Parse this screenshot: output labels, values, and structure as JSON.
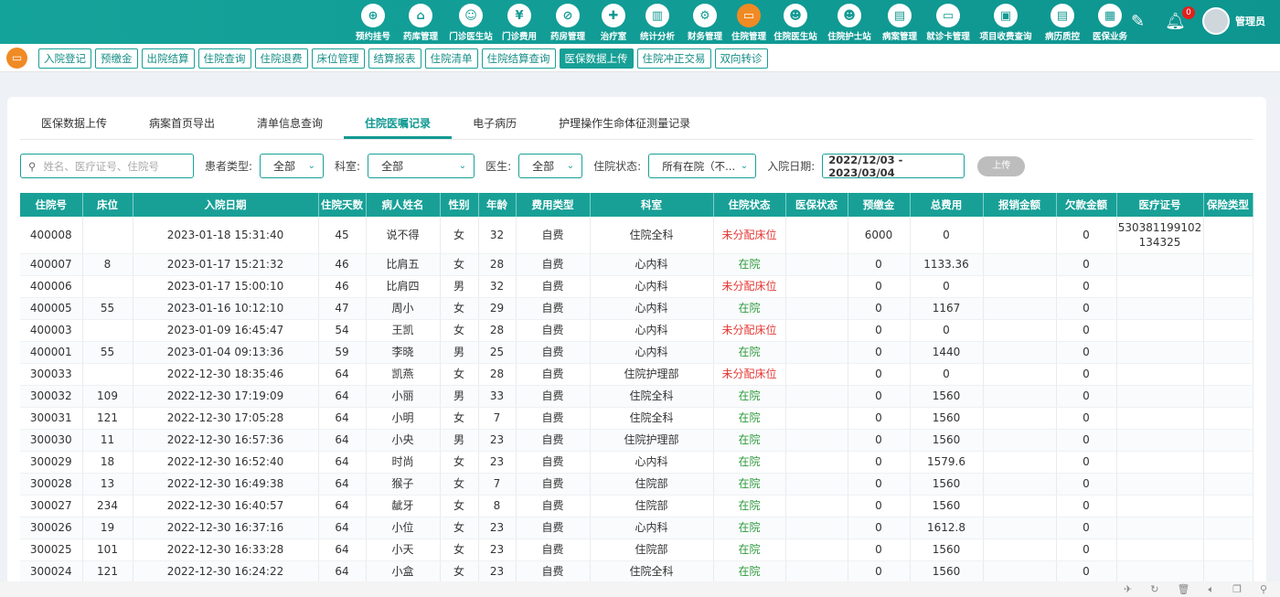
{
  "nav": [
    {
      "label": "预约挂号",
      "icon": "calendar-plus-icon",
      "g": "⊕"
    },
    {
      "label": "药库管理",
      "icon": "warehouse-icon",
      "g": "⌂"
    },
    {
      "label": "门诊医生站",
      "icon": "doctor-icon",
      "g": "☺"
    },
    {
      "label": "门诊费用",
      "icon": "yen-icon",
      "g": "¥"
    },
    {
      "label": "药房管理",
      "icon": "pill-icon",
      "g": "⊘"
    },
    {
      "label": "治疗室",
      "icon": "nurse-icon",
      "g": "✚"
    },
    {
      "label": "统计分析",
      "icon": "chart-icon",
      "g": "▥"
    },
    {
      "label": "财务管理",
      "icon": "gear-icon",
      "g": "⚙"
    },
    {
      "label": "住院管理",
      "icon": "bed-icon",
      "g": "▭",
      "active": true
    },
    {
      "label": "住院医生站",
      "icon": "doctor-card-icon",
      "g": "☻"
    },
    {
      "label": "住院护士站",
      "icon": "nurse-station-icon",
      "g": "☻"
    },
    {
      "label": "病案管理",
      "icon": "record-icon",
      "g": "▤"
    },
    {
      "label": "就诊卡管理",
      "icon": "card-icon",
      "g": "▭"
    },
    {
      "label": "项目收费查询",
      "icon": "search-doc-icon",
      "g": "▣"
    },
    {
      "label": "病历质控",
      "icon": "quality-icon",
      "g": "▤"
    },
    {
      "label": "医保业务",
      "icon": "insurance-icon",
      "g": "▦"
    }
  ],
  "header": {
    "notifications": "0",
    "user": "管理员"
  },
  "subnav": [
    {
      "label": "入院登记"
    },
    {
      "label": "预缴金"
    },
    {
      "label": "出院结算"
    },
    {
      "label": "住院查询"
    },
    {
      "label": "住院退费"
    },
    {
      "label": "床位管理"
    },
    {
      "label": "结算报表"
    },
    {
      "label": "住院清单"
    },
    {
      "label": "住院结算查询"
    },
    {
      "label": "医保数据上传",
      "active": true
    },
    {
      "label": "住院冲正交易"
    },
    {
      "label": "双向转诊"
    }
  ],
  "tabs": [
    {
      "label": "医保数据上传"
    },
    {
      "label": "病案首页导出"
    },
    {
      "label": "清单信息查询"
    },
    {
      "label": "住院医嘱记录",
      "active": true
    },
    {
      "label": "电子病历"
    },
    {
      "label": "护理操作生命体征测量记录"
    }
  ],
  "filters": {
    "search_placeholder": "姓名、医疗证号、住院号",
    "patient_type_label": "患者类型:",
    "patient_type": "全部",
    "dept_label": "科室:",
    "dept": "全部",
    "doctor_label": "医生:",
    "doctor": "全部",
    "status_label": "住院状态:",
    "status": "所有在院（不...",
    "date_label": "入院日期:",
    "date": "2022/12/03 - 2023/03/04",
    "upload": "上传"
  },
  "table": {
    "columns": [
      "住院号",
      "床位",
      "入院日期",
      "住院天数",
      "病人姓名",
      "性别",
      "年龄",
      "费用类型",
      "科室",
      "住院状态",
      "医保状态",
      "预缴金",
      "总费用",
      "报销金额",
      "欠款金额",
      "医疗证号",
      "保险类型"
    ],
    "rows": [
      [
        "400008",
        "",
        "2023-01-18 15:31:40",
        "45",
        "说不得",
        "女",
        "32",
        "自费",
        "住院全科",
        "未分配床位",
        "",
        "6000",
        "0",
        "",
        "0",
        "530381199102134325",
        ""
      ],
      [
        "400007",
        "8",
        "2023-01-17 15:21:32",
        "46",
        "比肩五",
        "女",
        "28",
        "自费",
        "心内科",
        "在院",
        "",
        "0",
        "1133.36",
        "",
        "0",
        "",
        ""
      ],
      [
        "400006",
        "",
        "2023-01-17 15:00:10",
        "46",
        "比肩四",
        "男",
        "32",
        "自费",
        "心内科",
        "未分配床位",
        "",
        "0",
        "0",
        "",
        "0",
        "",
        ""
      ],
      [
        "400005",
        "55",
        "2023-01-16 10:12:10",
        "47",
        "周小",
        "女",
        "29",
        "自费",
        "心内科",
        "在院",
        "",
        "0",
        "1167",
        "",
        "0",
        "",
        ""
      ],
      [
        "400003",
        "",
        "2023-01-09 16:45:47",
        "54",
        "王凯",
        "女",
        "28",
        "自费",
        "心内科",
        "未分配床位",
        "",
        "0",
        "0",
        "",
        "0",
        "",
        ""
      ],
      [
        "400001",
        "55",
        "2023-01-04 09:13:36",
        "59",
        "李晓",
        "男",
        "25",
        "自费",
        "心内科",
        "在院",
        "",
        "0",
        "1440",
        "",
        "0",
        "",
        ""
      ],
      [
        "300033",
        "",
        "2022-12-30 18:35:46",
        "64",
        "凯燕",
        "女",
        "28",
        "自费",
        "住院护理部",
        "未分配床位",
        "",
        "0",
        "0",
        "",
        "0",
        "",
        ""
      ],
      [
        "300032",
        "109",
        "2022-12-30 17:19:09",
        "64",
        "小丽",
        "男",
        "33",
        "自费",
        "住院全科",
        "在院",
        "",
        "0",
        "1560",
        "",
        "0",
        "",
        ""
      ],
      [
        "300031",
        "121",
        "2022-12-30 17:05:28",
        "64",
        "小明",
        "女",
        "7",
        "自费",
        "住院全科",
        "在院",
        "",
        "0",
        "1560",
        "",
        "0",
        "",
        ""
      ],
      [
        "300030",
        "11",
        "2022-12-30 16:57:36",
        "64",
        "小央",
        "男",
        "23",
        "自费",
        "住院护理部",
        "在院",
        "",
        "0",
        "1560",
        "",
        "0",
        "",
        ""
      ],
      [
        "300029",
        "18",
        "2022-12-30 16:52:40",
        "64",
        "时尚",
        "女",
        "23",
        "自费",
        "心内科",
        "在院",
        "",
        "0",
        "1579.6",
        "",
        "0",
        "",
        ""
      ],
      [
        "300028",
        "13",
        "2022-12-30 16:49:38",
        "64",
        "猴子",
        "女",
        "7",
        "自费",
        "住院部",
        "在院",
        "",
        "0",
        "1560",
        "",
        "0",
        "",
        ""
      ],
      [
        "300027",
        "234",
        "2022-12-30 16:40:57",
        "64",
        "龇牙",
        "女",
        "8",
        "自费",
        "住院部",
        "在院",
        "",
        "0",
        "1560",
        "",
        "0",
        "",
        ""
      ],
      [
        "300026",
        "19",
        "2022-12-30 16:37:16",
        "64",
        "小位",
        "女",
        "23",
        "自费",
        "心内科",
        "在院",
        "",
        "0",
        "1612.8",
        "",
        "0",
        "",
        ""
      ],
      [
        "300025",
        "101",
        "2022-12-30 16:33:28",
        "64",
        "小天",
        "女",
        "23",
        "自费",
        "住院部",
        "在院",
        "",
        "0",
        "1560",
        "",
        "0",
        "",
        ""
      ],
      [
        "300024",
        "121",
        "2022-12-30 16:24:22",
        "64",
        "小盒",
        "女",
        "23",
        "自费",
        "住院全科",
        "在院",
        "",
        "0",
        "1560",
        "",
        "0",
        "",
        ""
      ]
    ]
  },
  "statusbar": [
    "rocket-icon",
    "refresh-icon",
    "trash-icon",
    "volume-icon",
    "window-icon",
    "search-icon"
  ],
  "colors": {
    "primary": "#18a097",
    "active_nav": "#f08a24",
    "unassigned": "#e53935",
    "in_hospital": "#2e9a3c"
  }
}
